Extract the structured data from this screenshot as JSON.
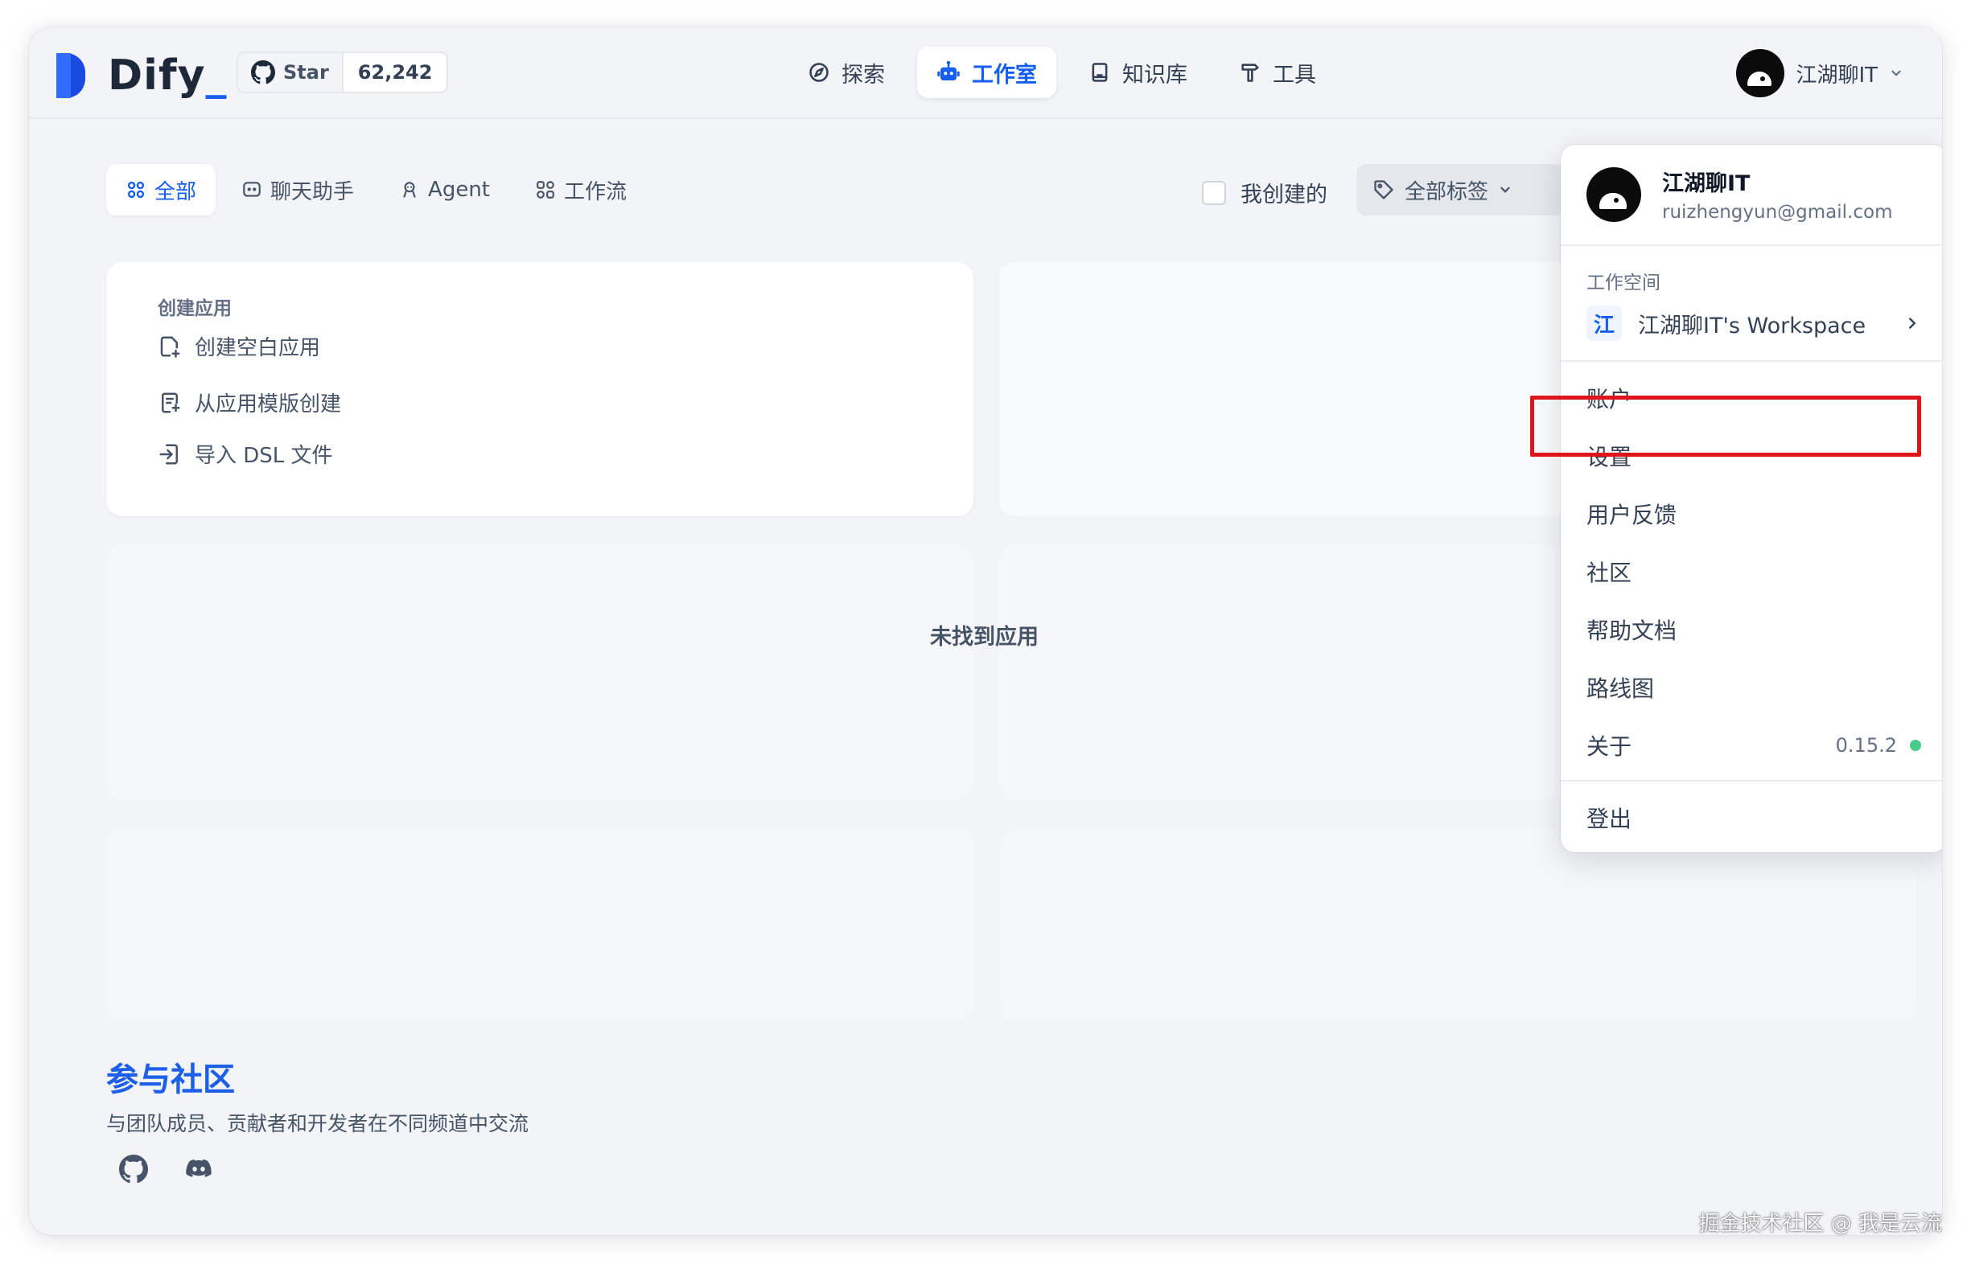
{
  "header": {
    "logo_text": "Dify",
    "logo_underscore": "_",
    "github_star_label": "Star",
    "github_star_count": "62,242",
    "nav": [
      {
        "label": "探索",
        "icon": "compass-icon"
      },
      {
        "label": "工作室",
        "icon": "robot-icon",
        "active": true
      },
      {
        "label": "知识库",
        "icon": "book-icon"
      },
      {
        "label": "工具",
        "icon": "hammer-icon"
      }
    ],
    "user_name": "江湖聊IT"
  },
  "filters": {
    "tabs": [
      {
        "label": "全部",
        "icon": "grid-icon",
        "active": true
      },
      {
        "label": "聊天助手",
        "icon": "chat-icon"
      },
      {
        "label": "Agent",
        "icon": "agent-icon"
      },
      {
        "label": "工作流",
        "icon": "workflow-icon"
      }
    ],
    "mine_label": "我创建的",
    "tags_label": "全部标签"
  },
  "create_card": {
    "title": "创建应用",
    "items": [
      "创建空白应用",
      "从应用模版创建",
      "导入 DSL 文件"
    ]
  },
  "empty_text": "未找到应用",
  "community": {
    "title": "参与社区",
    "subtitle": "与团队成员、贡献者和开发者在不同频道中交流"
  },
  "dropdown": {
    "user_name": "江湖聊IT",
    "email": "ruizhengyun@gmail.com",
    "workspace_label": "工作空间",
    "workspace_badge": "江",
    "workspace_name": "江湖聊IT's Workspace",
    "items": [
      "账户",
      "设置",
      "用户反馈",
      "社区",
      "帮助文档",
      "路线图",
      "关于"
    ],
    "version": "0.15.2",
    "logout": "登出",
    "highlighted_item": "设置",
    "highlight_color": "#e0141b"
  },
  "watermark": "掘金技术社区 @ 我是云流",
  "colors": {
    "accent": "#155eef",
    "status_online": "#47cd89"
  }
}
